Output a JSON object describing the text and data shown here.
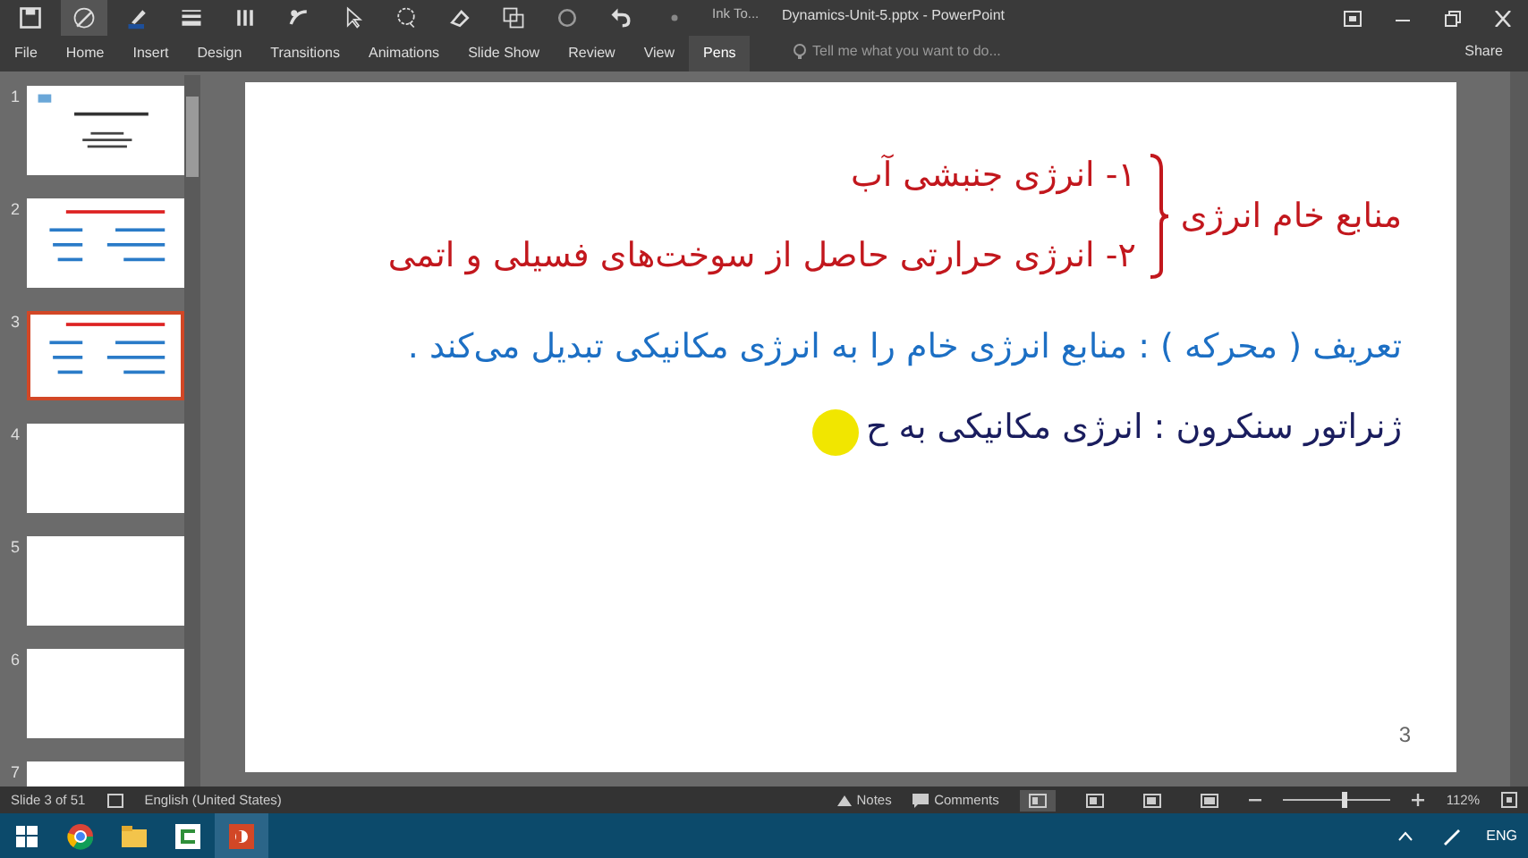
{
  "window": {
    "title": "Dynamics-Unit-5.pptx - PowerPoint",
    "context_group": "Ink To...",
    "tell_me": {
      "placeholder": "Tell me what you want to do..."
    },
    "share": "Share"
  },
  "toolbar": [
    {
      "kind": "save",
      "selected": false
    },
    {
      "kind": "pen",
      "selected": true
    },
    {
      "kind": "highlighter",
      "selected": false
    },
    {
      "kind": "thickness",
      "selected": false
    },
    {
      "kind": "color",
      "selected": false
    },
    {
      "kind": "shapes",
      "selected": false
    },
    {
      "kind": "select",
      "selected": false
    },
    {
      "kind": "lasso",
      "selected": false
    },
    {
      "kind": "eraser",
      "selected": false
    },
    {
      "kind": "convert",
      "selected": false
    },
    {
      "kind": "replay",
      "selected": false
    },
    {
      "kind": "undo",
      "selected": false
    },
    {
      "kind": "redo",
      "selected": false
    }
  ],
  "tabs": [
    {
      "label": "File",
      "selected": false
    },
    {
      "label": "Home",
      "selected": false
    },
    {
      "label": "Insert",
      "selected": false
    },
    {
      "label": "Design",
      "selected": false
    },
    {
      "label": "Transitions",
      "selected": false
    },
    {
      "label": "Animations",
      "selected": false
    },
    {
      "label": "Slide Show",
      "selected": false
    },
    {
      "label": "Review",
      "selected": false
    },
    {
      "label": "View",
      "selected": false
    },
    {
      "label": "Pens",
      "selected": true
    }
  ],
  "thumbnails": [
    {
      "number": "1",
      "selected": false,
      "kind": "title"
    },
    {
      "number": "2",
      "selected": false,
      "kind": "notes"
    },
    {
      "number": "3",
      "selected": true,
      "kind": "notes"
    },
    {
      "number": "4",
      "selected": false,
      "kind": "blank"
    },
    {
      "number": "5",
      "selected": false,
      "kind": "blank"
    },
    {
      "number": "6",
      "selected": false,
      "kind": "blank"
    },
    {
      "number": "7",
      "selected": false,
      "kind": "blank"
    }
  ],
  "slide": {
    "heading": "منابع خام انرژی",
    "items": [
      {
        "text": "۱- انرژی جنبشی آب"
      },
      {
        "text": "۲- انرژی حرارتی حاصل از سوخت‌های فسیلی و اتمی"
      }
    ],
    "lines": [
      {
        "text": "تعریف ( محرکه ) : منابع انرژی خام را به انرژی مکانیکی تبدیل می‌کند .",
        "color": "#1c6fc4"
      },
      {
        "text": "ژنراتور سنکرون : انرژی مکانیکی به ح",
        "color": "#1a1d5e"
      }
    ],
    "page_number": "3"
  },
  "status_bar": {
    "slide": "Slide 3 of 51",
    "language": "English (United States)",
    "notes": "Notes",
    "comments": "Comments",
    "zoom": {
      "level": 0.55,
      "reading": "112%"
    }
  },
  "taskbar": {
    "apps": [
      {
        "kind": "start",
        "selected": false
      },
      {
        "kind": "browser",
        "selected": false
      },
      {
        "kind": "files",
        "selected": false
      },
      {
        "kind": "recorder",
        "selected": false
      },
      {
        "kind": "powerpoint",
        "selected": true
      }
    ],
    "language": "ENG"
  }
}
